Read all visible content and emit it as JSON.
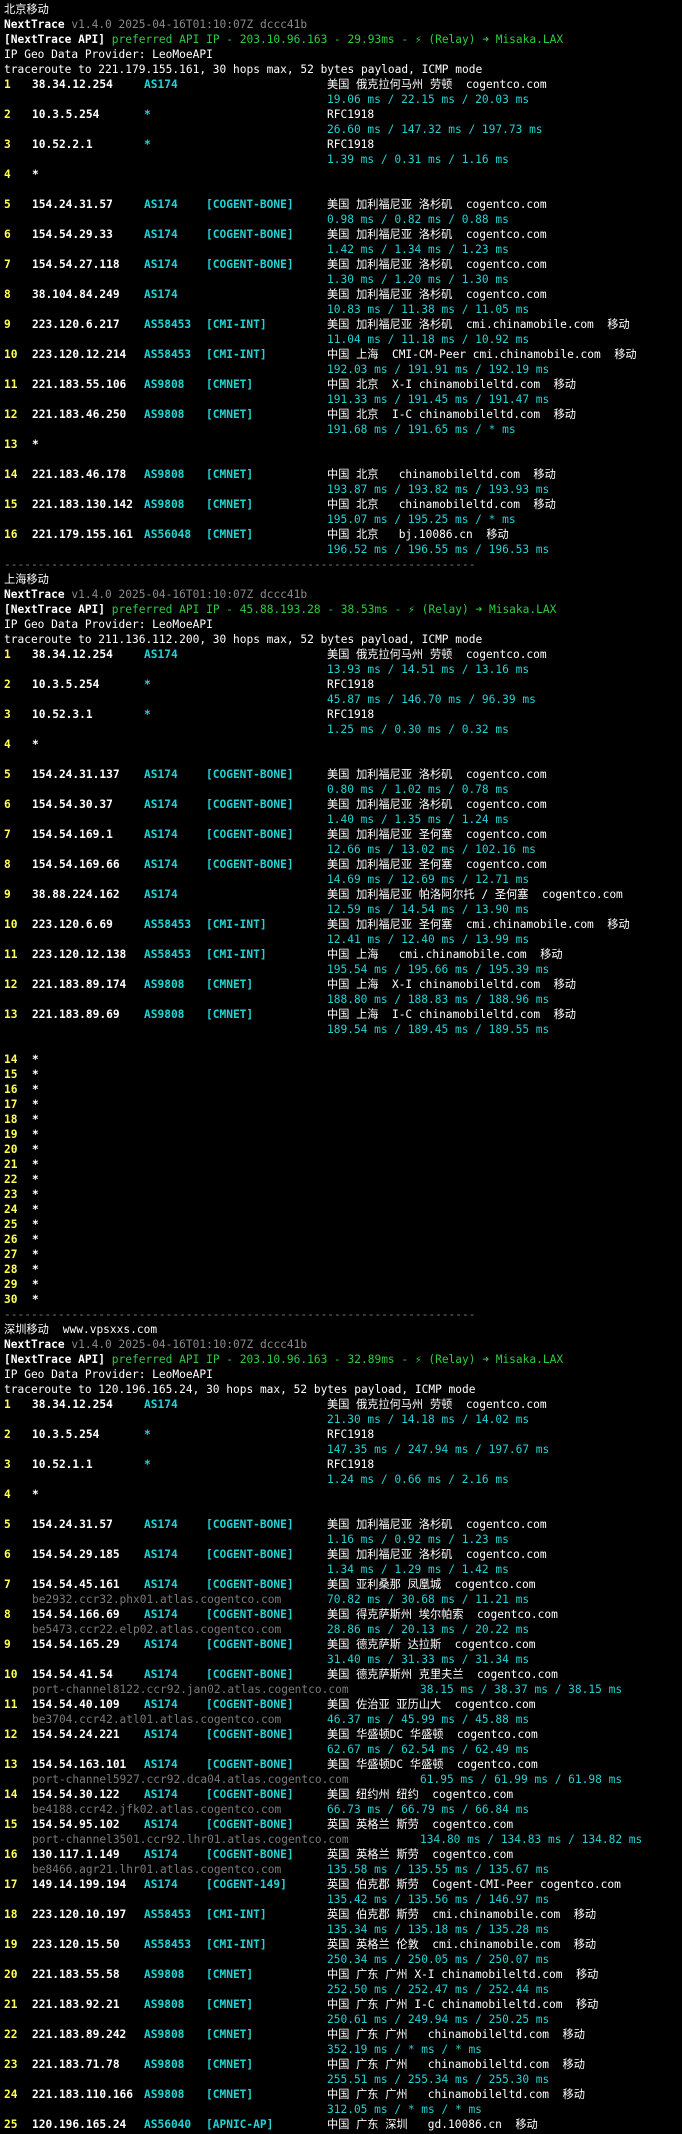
{
  "watermark": "www.vpsxxs.com",
  "sections": [
    {
      "label": "北京移动",
      "nt_name": "NextTrace",
      "nt_version": "v1.4.0 2025-04-16T01:10:07Z dccc41b",
      "api_tag": "[NextTrace API]",
      "api_text": " preferred API IP - 203.10.96.163 - 29.93ms - ⚡ (Relay) ➜ Misaka.LAX",
      "geo_provider": "IP Geo Data Provider: LeoMoeAPI",
      "traceroute": "traceroute to 221.179.155.161, 30 hops max, 52 bytes payload, ICMP mode",
      "divider": "----------------------------------------------------------------------",
      "hops": [
        {
          "no": "1",
          "ip": "38.34.12.254",
          "asn": "AS174",
          "tag": "",
          "geo": "美国 俄克拉何马州 劳顿  cogentco.com",
          "rtt": "19.06 ms / 22.15 ms / 20.03 ms"
        },
        {
          "no": "2",
          "ip": "10.3.5.254",
          "asn": "*",
          "tag": "",
          "geo": "RFC1918",
          "rtt": "26.60 ms / 147.32 ms / 197.73 ms"
        },
        {
          "no": "3",
          "ip": "10.52.2.1",
          "asn": "*",
          "tag": "",
          "geo": "RFC1918",
          "rtt": "1.39 ms / 0.31 ms / 1.16 ms"
        },
        {
          "no": "4",
          "ip": "*"
        },
        {
          "no": "5",
          "ip": "154.24.31.57",
          "asn": "AS174",
          "tag": "[COGENT-BONE]",
          "geo": "美国 加利福尼亚 洛杉矶  cogentco.com",
          "rtt": "0.98 ms / 0.82 ms / 0.88 ms"
        },
        {
          "no": "6",
          "ip": "154.54.29.33",
          "asn": "AS174",
          "tag": "[COGENT-BONE]",
          "geo": "美国 加利福尼亚 洛杉矶  cogentco.com",
          "rtt": "1.42 ms / 1.34 ms / 1.23 ms"
        },
        {
          "no": "7",
          "ip": "154.54.27.118",
          "asn": "AS174",
          "tag": "[COGENT-BONE]",
          "geo": "美国 加利福尼亚 洛杉矶  cogentco.com",
          "rtt": "1.30 ms / 1.20 ms / 1.30 ms"
        },
        {
          "no": "8",
          "ip": "38.104.84.249",
          "asn": "AS174",
          "tag": "",
          "geo": "美国 加利福尼亚 洛杉矶  cogentco.com",
          "rtt": "10.83 ms / 11.38 ms / 11.05 ms"
        },
        {
          "no": "9",
          "ip": "223.120.6.217",
          "asn": "AS58453",
          "tag": "[CMI-INT]",
          "geo": "美国 加利福尼亚 洛杉矶  cmi.chinamobile.com  移动",
          "rtt": "11.04 ms / 11.18 ms / 10.92 ms"
        },
        {
          "no": "10",
          "ip": "223.120.12.214",
          "asn": "AS58453",
          "tag": "[CMI-INT]",
          "geo": "中国 上海  CMI-CM-Peer cmi.chinamobile.com  移动",
          "rtt": "192.03 ms / 191.91 ms / 192.19 ms"
        },
        {
          "no": "11",
          "ip": "221.183.55.106",
          "asn": "AS9808",
          "tag": "[CMNET]",
          "geo": "中国 北京  X-I chinamobileltd.com  移动",
          "rtt": "191.33 ms / 191.45 ms / 191.47 ms"
        },
        {
          "no": "12",
          "ip": "221.183.46.250",
          "asn": "AS9808",
          "tag": "[CMNET]",
          "geo": "中国 北京  I-C chinamobileltd.com  移动",
          "rtt": "191.68 ms / 191.65 ms / * ms"
        },
        {
          "no": "13",
          "ip": "*"
        },
        {
          "no": "14",
          "ip": "221.183.46.178",
          "asn": "AS9808",
          "tag": "[CMNET]",
          "geo": "中国 北京   chinamobileltd.com  移动",
          "rtt": "193.87 ms / 193.82 ms / 193.93 ms"
        },
        {
          "no": "15",
          "ip": "221.183.130.142",
          "asn": "AS9808",
          "tag": "[CMNET]",
          "geo": "中国 北京   chinamobileltd.com  移动",
          "rtt": "195.07 ms / 195.25 ms / * ms"
        },
        {
          "no": "16",
          "ip": "221.179.155.161",
          "asn": "AS56048",
          "tag": "[CMNET]",
          "geo": "中国 北京   bj.10086.cn  移动",
          "rtt": "196.52 ms / 196.55 ms / 196.53 ms"
        }
      ]
    },
    {
      "label": "上海移动",
      "nt_name": "NextTrace",
      "nt_version": "v1.4.0 2025-04-16T01:10:07Z dccc41b",
      "api_tag": "[NextTrace API]",
      "api_text": " preferred API IP - 45.88.193.28 - 38.53ms - ⚡ (Relay) ➜ Misaka.LAX",
      "geo_provider": "IP Geo Data Provider: LeoMoeAPI",
      "traceroute": "traceroute to 211.136.112.200, 30 hops max, 52 bytes payload, ICMP mode",
      "divider": "----------------------------------------------------------------------",
      "hops": [
        {
          "no": "1",
          "ip": "38.34.12.254",
          "asn": "AS174",
          "tag": "",
          "geo": "美国 俄克拉何马州 劳顿  cogentco.com",
          "rtt": "13.93 ms / 14.51 ms / 13.16 ms"
        },
        {
          "no": "2",
          "ip": "10.3.5.254",
          "asn": "*",
          "tag": "",
          "geo": "RFC1918",
          "rtt": "45.87 ms / 146.70 ms / 96.39 ms"
        },
        {
          "no": "3",
          "ip": "10.52.3.1",
          "asn": "*",
          "tag": "",
          "geo": "RFC1918",
          "rtt": "1.25 ms / 0.30 ms / 0.32 ms"
        },
        {
          "no": "4",
          "ip": "*"
        },
        {
          "no": "5",
          "ip": "154.24.31.137",
          "asn": "AS174",
          "tag": "[COGENT-BONE]",
          "geo": "美国 加利福尼亚 洛杉矶  cogentco.com",
          "rtt": "0.80 ms / 1.02 ms / 0.78 ms"
        },
        {
          "no": "6",
          "ip": "154.54.30.37",
          "asn": "AS174",
          "tag": "[COGENT-BONE]",
          "geo": "美国 加利福尼亚 洛杉矶  cogentco.com",
          "rtt": "1.40 ms / 1.35 ms / 1.24 ms"
        },
        {
          "no": "7",
          "ip": "154.54.169.1",
          "asn": "AS174",
          "tag": "[COGENT-BONE]",
          "geo": "美国 加利福尼亚 圣何塞  cogentco.com",
          "rtt": "12.66 ms / 13.02 ms / 102.16 ms"
        },
        {
          "no": "8",
          "ip": "154.54.169.66",
          "asn": "AS174",
          "tag": "[COGENT-BONE]",
          "geo": "美国 加利福尼亚 圣何塞  cogentco.com",
          "rtt": "14.69 ms / 12.69 ms / 12.71 ms"
        },
        {
          "no": "9",
          "ip": "38.88.224.162",
          "asn": "AS174",
          "tag": "",
          "geo": "美国 加利福尼亚 帕洛阿尔托 / 圣何塞  cogentco.com",
          "rtt": "12.59 ms / 14.54 ms / 13.90 ms"
        },
        {
          "no": "10",
          "ip": "223.120.6.69",
          "asn": "AS58453",
          "tag": "[CMI-INT]",
          "geo": "美国 加利福尼亚 圣何塞  cmi.chinamobile.com  移动",
          "rtt": "12.41 ms / 12.40 ms / 13.99 ms"
        },
        {
          "no": "11",
          "ip": "223.120.12.138",
          "asn": "AS58453",
          "tag": "[CMI-INT]",
          "geo": "中国 上海   cmi.chinamobile.com  移动",
          "rtt": "195.54 ms / 195.66 ms / 195.39 ms"
        },
        {
          "no": "12",
          "ip": "221.183.89.174",
          "asn": "AS9808",
          "tag": "[CMNET]",
          "geo": "中国 上海  X-I chinamobileltd.com  移动",
          "rtt": "188.80 ms / 188.83 ms / 188.96 ms"
        },
        {
          "no": "13",
          "ip": "221.183.89.69",
          "asn": "AS9808",
          "tag": "[CMNET]",
          "geo": "中国 上海  I-C chinamobileltd.com  移动",
          "rtt": "189.54 ms / 189.45 ms / 189.55 ms"
        },
        {
          "no": "",
          "ip": ""
        },
        {
          "no": "14",
          "ip": "*"
        },
        {
          "no": "15",
          "ip": "*"
        },
        {
          "no": "16",
          "ip": "*"
        },
        {
          "no": "17",
          "ip": "*"
        },
        {
          "no": "18",
          "ip": "*"
        },
        {
          "no": "19",
          "ip": "*"
        },
        {
          "no": "20",
          "ip": "*"
        },
        {
          "no": "21",
          "ip": "*"
        },
        {
          "no": "22",
          "ip": "*"
        },
        {
          "no": "23",
          "ip": "*"
        },
        {
          "no": "24",
          "ip": "*"
        },
        {
          "no": "25",
          "ip": "*"
        },
        {
          "no": "26",
          "ip": "*"
        },
        {
          "no": "27",
          "ip": "*"
        },
        {
          "no": "28",
          "ip": "*"
        },
        {
          "no": "29",
          "ip": "*"
        },
        {
          "no": "30",
          "ip": "*"
        }
      ]
    },
    {
      "label": "深圳移动",
      "nt_name": "NextTrace",
      "nt_version": "v1.4.0 2025-04-16T01:10:07Z dccc41b",
      "api_tag": "[NextTrace API]",
      "api_text": " preferred API IP - 203.10.96.163 - 32.89ms - ⚡ (Relay) ➜ Misaka.LAX",
      "geo_provider": "IP Geo Data Provider: LeoMoeAPI",
      "traceroute": "traceroute to 120.196.165.24, 30 hops max, 52 bytes payload, ICMP mode",
      "divider": "",
      "hops": [
        {
          "no": "1",
          "ip": "38.34.12.254",
          "asn": "AS174",
          "tag": "",
          "geo": "美国 俄克拉何马州 劳顿  cogentco.com",
          "rtt": "21.30 ms / 14.18 ms / 14.02 ms"
        },
        {
          "no": "2",
          "ip": "10.3.5.254",
          "asn": "*",
          "tag": "",
          "geo": "RFC1918",
          "rtt": "147.35 ms / 247.94 ms / 197.67 ms"
        },
        {
          "no": "3",
          "ip": "10.52.1.1",
          "asn": "*",
          "tag": "",
          "geo": "RFC1918",
          "rtt": "1.24 ms / 0.66 ms / 2.16 ms"
        },
        {
          "no": "4",
          "ip": "*"
        },
        {
          "no": "5",
          "ip": "154.24.31.57",
          "asn": "AS174",
          "tag": "[COGENT-BONE]",
          "geo": "美国 加利福尼亚 洛杉矶  cogentco.com",
          "rtt": "1.16 ms / 0.92 ms / 1.23 ms"
        },
        {
          "no": "6",
          "ip": "154.54.29.185",
          "asn": "AS174",
          "tag": "[COGENT-BONE]",
          "geo": "美国 加利福尼亚 洛杉矶  cogentco.com",
          "rtt": "1.34 ms / 1.29 ms / 1.42 ms"
        },
        {
          "no": "7",
          "ip": "154.54.45.161",
          "asn": "AS174",
          "tag": "[COGENT-BONE]",
          "geo": "美国 亚利桑那 凤凰城  cogentco.com",
          "rdns": "be2932.ccr32.phx01.atlas.cogentco.com",
          "rtt": "70.82 ms / 30.68 ms / 11.21 ms"
        },
        {
          "no": "8",
          "ip": "154.54.166.69",
          "asn": "AS174",
          "tag": "[COGENT-BONE]",
          "geo": "美国 得克萨斯州 埃尔帕索  cogentco.com",
          "rdns": "be5473.ccr22.elp02.atlas.cogentco.com",
          "rtt": "28.86 ms / 20.13 ms / 20.22 ms"
        },
        {
          "no": "9",
          "ip": "154.54.165.29",
          "asn": "AS174",
          "tag": "[COGENT-BONE]",
          "geo": "美国 德克萨斯 达拉斯  cogentco.com",
          "rtt": "31.40 ms / 31.33 ms / 31.34 ms"
        },
        {
          "no": "10",
          "ip": "154.54.41.54",
          "asn": "AS174",
          "tag": "[COGENT-BONE]",
          "geo": "美国 德克萨斯州 克里夫兰  cogentco.com",
          "rdns": "port-channel8122.ccr92.jan02.atlas.cogentco.com",
          "rtt": "38.15 ms / 38.37 ms / 38.15 ms",
          "rtt_wide": true
        },
        {
          "no": "11",
          "ip": "154.54.40.109",
          "asn": "AS174",
          "tag": "[COGENT-BONE]",
          "geo": "美国 佐治亚 亚历山大  cogentco.com",
          "rdns": "be3704.ccr42.atl01.atlas.cogentco.com",
          "rtt": "46.37 ms / 45.99 ms / 45.88 ms"
        },
        {
          "no": "12",
          "ip": "154.54.24.221",
          "asn": "AS174",
          "tag": "[COGENT-BONE]",
          "geo": "美国 华盛顿DC 华盛顿  cogentco.com",
          "rtt": "62.67 ms / 62.54 ms / 62.49 ms"
        },
        {
          "no": "13",
          "ip": "154.54.163.101",
          "asn": "AS174",
          "tag": "[COGENT-BONE]",
          "geo": "美国 华盛顿DC 华盛顿  cogentco.com",
          "rdns": "port-channel5927.ccr92.dca04.atlas.cogentco.com",
          "rtt": "61.95 ms / 61.99 ms / 61.98 ms",
          "rtt_wide": true
        },
        {
          "no": "14",
          "ip": "154.54.30.122",
          "asn": "AS174",
          "tag": "[COGENT-BONE]",
          "geo": "美国 纽约州 纽约  cogentco.com",
          "rdns": "be4188.ccr42.jfk02.atlas.cogentco.com",
          "rtt": "66.73 ms / 66.79 ms / 66.84 ms"
        },
        {
          "no": "15",
          "ip": "154.54.95.102",
          "asn": "AS174",
          "tag": "[COGENT-BONE]",
          "geo": "英国 英格兰 斯劳  cogentco.com",
          "rdns": "port-channel3501.ccr92.lhr01.atlas.cogentco.com",
          "rtt": "134.80 ms / 134.83 ms / 134.82 ms",
          "rtt_wide": true
        },
        {
          "no": "16",
          "ip": "130.117.1.149",
          "asn": "AS174",
          "tag": "[COGENT-BONE]",
          "geo": "英国 英格兰 斯劳  cogentco.com",
          "rdns": "be8466.agr21.lhr01.atlas.cogentco.com",
          "rtt": "135.58 ms / 135.55 ms / 135.67 ms"
        },
        {
          "no": "17",
          "ip": "149.14.199.194",
          "asn": "AS174",
          "tag": "[COGENT-149]",
          "geo": "英国 伯克郡 斯劳  Cogent-CMI-Peer cogentco.com",
          "rtt": "135.42 ms / 135.56 ms / 146.97 ms"
        },
        {
          "no": "18",
          "ip": "223.120.10.197",
          "asn": "AS58453",
          "tag": "[CMI-INT]",
          "geo": "英国 伯克郡 斯劳  cmi.chinamobile.com  移动",
          "rtt": "135.34 ms / 135.18 ms / 135.28 ms"
        },
        {
          "no": "19",
          "ip": "223.120.15.50",
          "asn": "AS58453",
          "tag": "[CMI-INT]",
          "geo": "英国 英格兰 伦敦  cmi.chinamobile.com  移动",
          "rtt": "250.34 ms / 250.05 ms / 250.07 ms"
        },
        {
          "no": "20",
          "ip": "221.183.55.58",
          "asn": "AS9808",
          "tag": "[CMNET]",
          "geo": "中国 广东 广州 X-I chinamobileltd.com  移动",
          "rtt": "252.50 ms / 252.47 ms / 252.44 ms"
        },
        {
          "no": "21",
          "ip": "221.183.92.21",
          "asn": "AS9808",
          "tag": "[CMNET]",
          "geo": "中国 广东 广州 I-C chinamobileltd.com  移动",
          "rtt": "250.61 ms / 249.94 ms / 250.25 ms"
        },
        {
          "no": "22",
          "ip": "221.183.89.242",
          "asn": "AS9808",
          "tag": "[CMNET]",
          "geo": "中国 广东 广州   chinamobileltd.com  移动",
          "rtt": "352.19 ms / * ms / * ms"
        },
        {
          "no": "23",
          "ip": "221.183.71.78",
          "asn": "AS9808",
          "tag": "[CMNET]",
          "geo": "中国 广东 广州   chinamobileltd.com  移动",
          "rtt": "255.51 ms / 255.34 ms / 255.30 ms"
        },
        {
          "no": "24",
          "ip": "221.183.110.166",
          "asn": "AS9808",
          "tag": "[CMNET]",
          "geo": "中国 广东 广州   chinamobileltd.com  移动",
          "rtt": "312.05 ms / * ms / * ms"
        },
        {
          "no": "25",
          "ip": "120.196.165.24",
          "asn": "AS56040",
          "tag": "[APNIC-AP]",
          "geo": "中国 广东 深圳   gd.10086.cn  移动",
          "rtt": ""
        }
      ]
    }
  ]
}
